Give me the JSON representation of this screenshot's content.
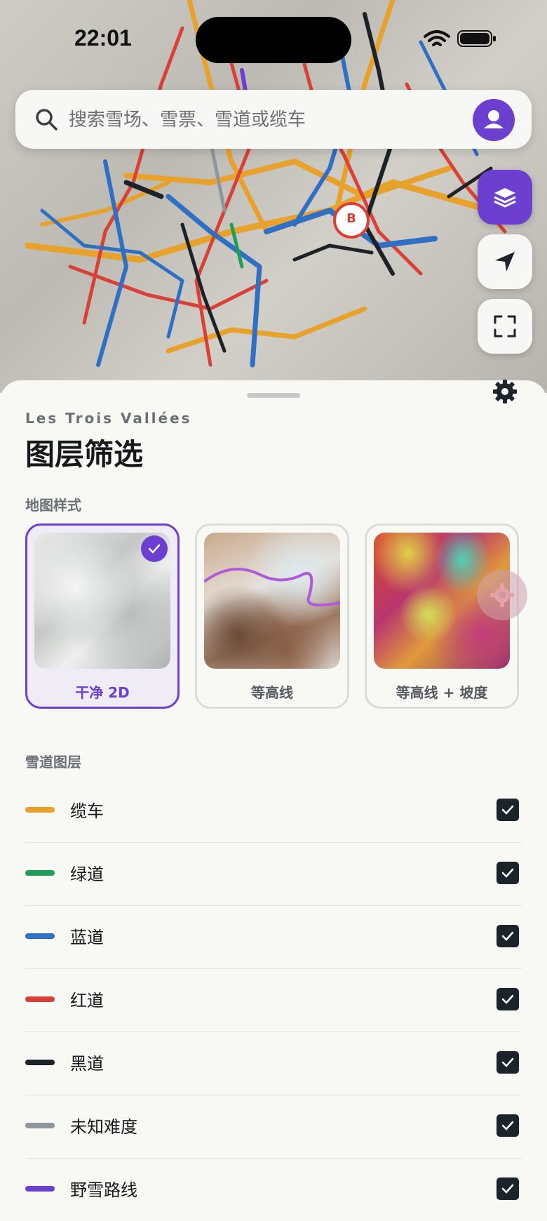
{
  "status_bar": {
    "time": "22:01"
  },
  "search": {
    "placeholder": "搜索雪场、雪票、雪道或缆车"
  },
  "map": {
    "marker_label": "B"
  },
  "sheet": {
    "resort_name": "Les Trois Vallées",
    "title": "图层筛选",
    "map_style_header": "地图样式",
    "map_styles": [
      {
        "label": "干净 2D",
        "selected": true
      },
      {
        "label": "等高线",
        "selected": false
      },
      {
        "label": "等高线 + 坡度",
        "selected": false
      }
    ],
    "layers_header": "雪道图层",
    "layers": [
      {
        "label": "缆车",
        "color": "#e8a22c",
        "checked": true
      },
      {
        "label": "绿道",
        "color": "#1f9e5a",
        "checked": true
      },
      {
        "label": "蓝道",
        "color": "#2f6fc4",
        "checked": true
      },
      {
        "label": "红道",
        "color": "#d94036",
        "checked": true
      },
      {
        "label": "黑道",
        "color": "#1d2226",
        "checked": true
      },
      {
        "label": "未知难度",
        "color": "#8e969c",
        "checked": true
      },
      {
        "label": "野雪路线",
        "color": "#6d3fd0",
        "checked": true
      }
    ]
  },
  "colors": {
    "accent": "#6d3fd0",
    "checkbox": "#1c232a"
  }
}
